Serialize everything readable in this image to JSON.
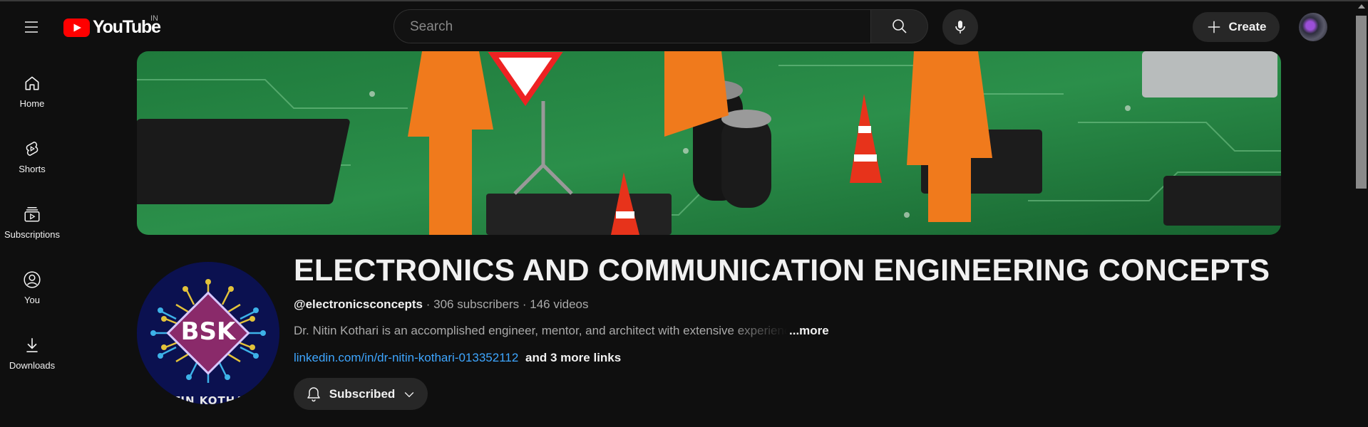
{
  "masthead": {
    "logo_text": "YouTube",
    "country_code": "IN",
    "search_placeholder": "Search",
    "create_label": "Create"
  },
  "sidebar": {
    "items": [
      {
        "label": "Home",
        "icon": "home-icon"
      },
      {
        "label": "Shorts",
        "icon": "shorts-icon"
      },
      {
        "label": "Subscriptions",
        "icon": "subscriptions-icon"
      },
      {
        "label": "You",
        "icon": "you-icon"
      },
      {
        "label": "Downloads",
        "icon": "downloads-icon"
      }
    ]
  },
  "channel": {
    "title": "ELECTRONICS AND COMMUNICATION ENGINEERING CONCEPTS",
    "handle": "@electronicsconcepts",
    "subscribers": "306 subscribers",
    "videos": "146 videos",
    "description": "Dr. Nitin Kothari is an accomplished engineer, mentor, and architect with extensive experience",
    "more_label": "...more",
    "link": "linkedin.com/in/dr-nitin-kothari-013352112",
    "more_links": "and 3 more links",
    "subscribe_state": "Subscribed",
    "avatar_initials": "BSK",
    "avatar_caption": "NITIN KOTHARI"
  },
  "colors": {
    "background": "#0f0f0f",
    "brand_red": "#ff0000",
    "link_blue": "#3ea6ff",
    "button_bg": "#272727"
  }
}
